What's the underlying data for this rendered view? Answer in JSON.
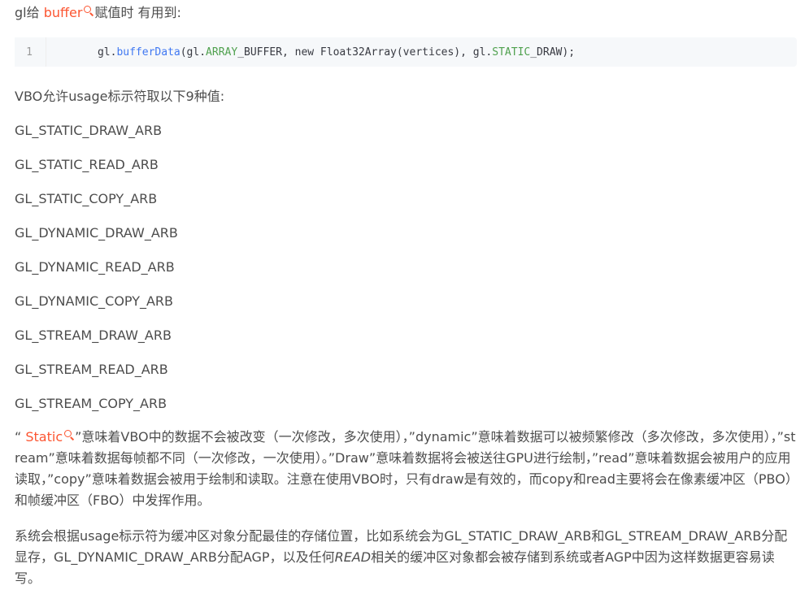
{
  "intro": {
    "prefix": "gl给 ",
    "link": "buffer",
    "suffix": "赋值时 有用到:"
  },
  "code": {
    "line_number": "1",
    "tokens": [
      {
        "text": "gl.",
        "kind": "plain"
      },
      {
        "text": "bufferData",
        "kind": "fn"
      },
      {
        "text": "(gl.",
        "kind": "plain"
      },
      {
        "text": "ARRAY",
        "kind": "const"
      },
      {
        "text": "_BUFFER, new Float32Array(vertices), gl.",
        "kind": "plain"
      },
      {
        "text": "STATIC",
        "kind": "const"
      },
      {
        "text": "_DRAW);",
        "kind": "plain"
      }
    ]
  },
  "usage_intro": "VBO允许usage标示符取以下9种值:",
  "usage_values": [
    "GL_STATIC_DRAW_ARB",
    "GL_STATIC_READ_ARB",
    "GL_STATIC_COPY_ARB",
    "GL_DYNAMIC_DRAW_ARB",
    "GL_DYNAMIC_READ_ARB",
    "GL_DYNAMIC_COPY_ARB",
    "GL_STREAM_DRAW_ARB",
    "GL_STREAM_READ_ARB",
    "GL_STREAM_COPY_ARB"
  ],
  "description": {
    "open_quote": "“ ",
    "link": "Static",
    "text": "”意味着VBO中的数据不会被改变（一次修改，多次使用），”dynamic”意味着数据可以被频繁修改（多次修改，多次使用），”stream”意味着数据每帧都不同（一次修改，一次使用）。”Draw”意味着数据将会被送往GPU进行绘制，”read”意味着数据会被用户的应用读取，”copy”意味着数据会被用于绘制和读取。注意在使用VBO时，只有draw是有效的，而copy和read主要将会在像素缓冲区（PBO）和帧缓冲区（FBO）中发挥作用。"
  },
  "final_paragraph": {
    "before": "系统会根据usage标示符为缓冲区对象分配最佳的存储位置，比如系统会为GL_STATIC_DRAW_ARB和GL_STREAM_DRAW_ARB分配显存，GL_DYNAMIC_DRAW_ARB分配AGP，以及任何",
    "italic": "READ",
    "after": "相关的缓冲区对象都会被存储到系统或者AGP中因为这样数据更容易读写。"
  },
  "colors": {
    "text": "#4d4d4d",
    "link": "#fc5531",
    "code_bg": "#f6f8fa",
    "code_fn": "#4078f2",
    "code_const": "#50a14f"
  },
  "icons": {
    "inline_search": "search-icon"
  }
}
